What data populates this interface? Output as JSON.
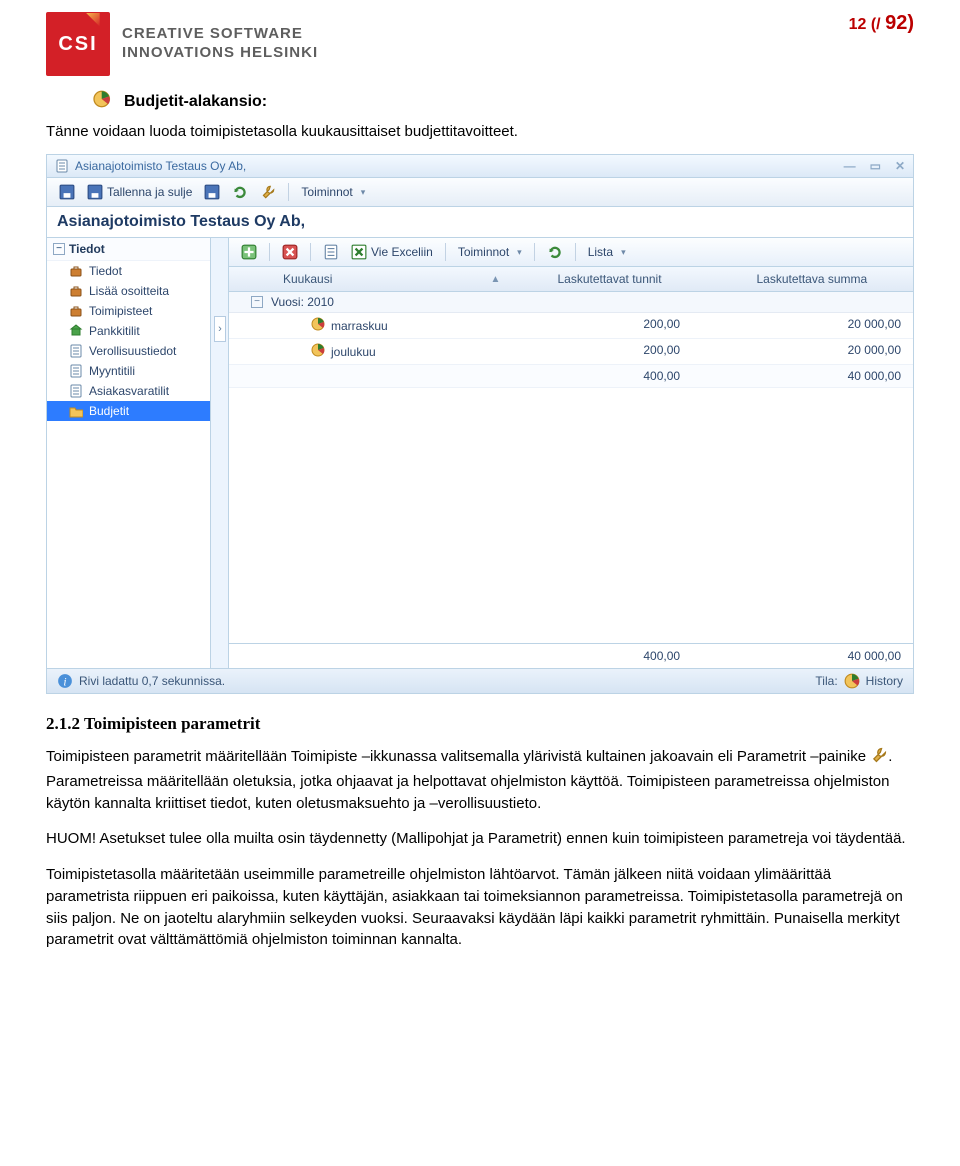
{
  "page": {
    "page_label_prefix": "12 (/ ",
    "page_label_suffix": "92",
    "page_label_close": ")"
  },
  "logo": {
    "abbrev": "CSI",
    "line1": "CREATIVE SOFTWARE",
    "line2": "INNOVATIONS HELSINKI"
  },
  "section_heading": "Budjetit-alakansio:",
  "intro_para": "Tänne voidaan luoda toimipistetasolla kuukausittaiset budjettitavoitteet.",
  "app": {
    "title": "Asianajotoimisto Testaus Oy Ab,",
    "toolbar": {
      "save_close": "Tallenna ja sulje",
      "toiminnot": "Toiminnot"
    },
    "title2": "Asianajotoimisto Testaus Oy Ab,",
    "sidebar": {
      "group": "Tiedot",
      "items": [
        {
          "id": "tiedot",
          "label": "Tiedot",
          "icon": "briefcase"
        },
        {
          "id": "lisaa",
          "label": "Lisää osoitteita",
          "icon": "briefcase"
        },
        {
          "id": "toimipisteet",
          "label": "Toimipisteet",
          "icon": "briefcase"
        },
        {
          "id": "pankkitilit",
          "label": "Pankkitilit",
          "icon": "bank"
        },
        {
          "id": "verollisuustiedot",
          "label": "Verollisuustiedot",
          "icon": "doc"
        },
        {
          "id": "myyntitili",
          "label": "Myyntitili",
          "icon": "doc"
        },
        {
          "id": "asiakasvaratilit",
          "label": "Asiakasvaratilit",
          "icon": "doc"
        },
        {
          "id": "budjetit",
          "label": "Budjetit",
          "icon": "folder",
          "selected": true
        }
      ]
    },
    "content_toolbar": {
      "vie_exceliin": "Vie Exceliin",
      "toiminnot": "Toiminnot",
      "lista": "Lista"
    },
    "grid": {
      "col_month": "Kuukausi",
      "col_hours": "Laskutettavat tunnit",
      "col_sum": "Laskutettava summa",
      "group_label": "Vuosi: 2010",
      "rows": [
        {
          "month": "marraskuu",
          "hours": "200,00",
          "sum": "20 000,00"
        },
        {
          "month": "joulukuu",
          "hours": "200,00",
          "sum": "20 000,00"
        }
      ],
      "group_total_hours": "400,00",
      "group_total_sum": "40 000,00",
      "footer_hours": "400,00",
      "footer_sum": "40 000,00"
    },
    "status": {
      "left_icon": "info",
      "left_text": "Rivi ladattu 0,7 sekunnissa.",
      "right_label": "Tila:",
      "right_value": "History"
    }
  },
  "section2_num": "2.1.2   Toimipisteen parametrit",
  "section2_p1a": "Toimipisteen parametrit määritellään Toimipiste –ikkunassa valitsemalla ylärivistä kultainen jakoavain eli Parametrit –painike ",
  "section2_p1b": ". Parametreissa määritellään oletuksia, jotka ohjaavat ja helpottavat ohjelmiston käyttöä. Toimipisteen parametreissa ohjelmiston käytön kannalta kriittiset tiedot, kuten oletusmaksuehto ja –verollisuustieto.",
  "section2_p2": "HUOM! Asetukset tulee olla muilta osin täydennetty (Mallipohjat ja Parametrit) ennen kuin toimipisteen parametreja voi täydentää.",
  "section2_p3": "Toimipistetasolla määritetään useimmille parametreille ohjelmiston lähtöarvot. Tämän jälkeen niitä voidaan ylimäärittää parametrista riippuen eri paikoissa, kuten käyttäjän, asiakkaan tai toimeksiannon parametreissa. Toimipistetasolla parametrejä on siis paljon. Ne on jaoteltu alaryhmiin selkeyden vuoksi. Seuraavaksi käydään läpi kaikki parametrit ryhmittäin. Punaisella merkityt parametrit ovat välttämättömiä ohjelmiston toiminnan kannalta."
}
